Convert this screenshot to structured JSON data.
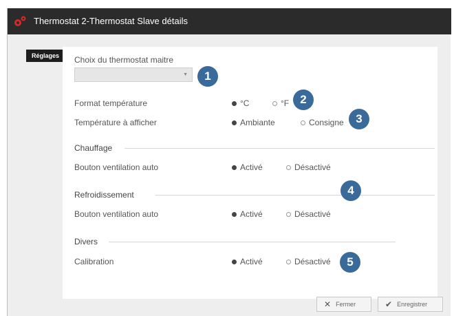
{
  "window": {
    "title": "Thermostat 2-Thermostat Slave détails"
  },
  "tabs": {
    "reglages": "Réglages"
  },
  "form": {
    "master_thermostat_label": "Choix du thermostat maitre",
    "master_thermostat_value": "",
    "temp_format_label": "Format température",
    "temp_format_options": [
      "°C",
      "°F"
    ],
    "temp_format_selected": "°C",
    "temp_display_label": "Température à afficher",
    "temp_display_options": [
      "Ambiante",
      "Consigne"
    ],
    "temp_display_selected": "Ambiante"
  },
  "sections": {
    "chauffage": {
      "title": "Chauffage",
      "field_label": "Bouton ventilation auto",
      "options": [
        "Activé",
        "Désactivé"
      ],
      "selected": "Activé"
    },
    "refroidissement": {
      "title": "Refroidissement",
      "field_label": "Bouton ventilation auto",
      "options": [
        "Activé",
        "Désactivé"
      ],
      "selected": "Activé"
    },
    "divers": {
      "title": "Divers",
      "field_label": "Calibration",
      "options": [
        "Activé",
        "Désactivé"
      ],
      "selected": "Activé"
    }
  },
  "badges": [
    "1",
    "2",
    "3",
    "4",
    "5"
  ],
  "footer": {
    "close_label": "Fermer",
    "save_label": "Enregistrer"
  },
  "colors": {
    "titlebar": "#2b2b2b",
    "badge": "#3a6a9a",
    "icon": "#d22a2a"
  },
  "icons": {
    "app": "gears-icon",
    "close": "x-icon",
    "save": "check-icon"
  }
}
